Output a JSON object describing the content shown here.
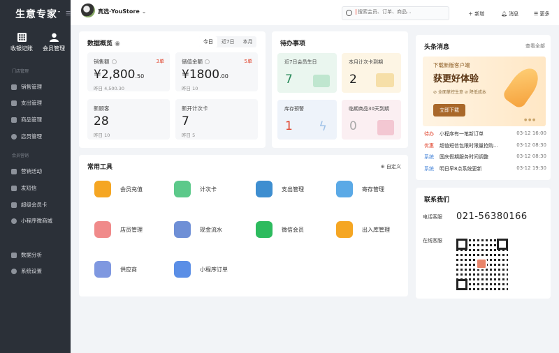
{
  "sidebar": {
    "logo": "生意专家",
    "logo_tm": "™",
    "top": [
      {
        "label": "收银记账"
      },
      {
        "label": "会员管理"
      }
    ],
    "section1": "门店管理",
    "items1": [
      {
        "label": "销售管理"
      },
      {
        "label": "支出管理"
      },
      {
        "label": "商品管理"
      },
      {
        "label": "店员管理"
      }
    ],
    "section2": "会员营销",
    "items2": [
      {
        "label": "营销活动"
      },
      {
        "label": "发短信"
      },
      {
        "label": "超级会员卡"
      },
      {
        "label": "小程序微商城"
      }
    ],
    "items3": [
      {
        "label": "数据分析"
      },
      {
        "label": "系统设置"
      }
    ]
  },
  "header": {
    "store": "真选·YouStore",
    "search_placeholder": "搜索会员、订单、商品...",
    "add": "新增",
    "messages": "消息",
    "more": "更多"
  },
  "overview": {
    "title": "数据概览",
    "tabs": [
      "今日",
      "近7日",
      "本月"
    ],
    "stats": [
      {
        "label": "销售额",
        "badge": "3单",
        "value": "¥2,800",
        "decimal": ".50",
        "sub": "昨日 4,500.30"
      },
      {
        "label": "储值金额",
        "badge": "5单",
        "value": "¥1800",
        "decimal": ".00",
        "sub": "昨日 10"
      },
      {
        "label": "新顾客",
        "value": "28",
        "sub": "昨日 10"
      },
      {
        "label": "新开计次卡",
        "value": "7",
        "sub": "昨日 5"
      }
    ]
  },
  "todo": {
    "title": "待办事项",
    "items": [
      {
        "label": "近7日会员生日",
        "value": "7",
        "color": "#2a8a5a"
      },
      {
        "label": "本月计次卡到期",
        "value": "2",
        "color": "#222"
      },
      {
        "label": "库存预警",
        "value": "1",
        "color": "#e0442d"
      },
      {
        "label": "临期商品30天到期",
        "value": "0",
        "color": "#aaa"
      }
    ]
  },
  "tools": {
    "title": "常用工具",
    "customize": "自定义",
    "items": [
      {
        "label": "会员充值",
        "color": "#f5a623"
      },
      {
        "label": "计次卡",
        "color": "#5cc98a"
      },
      {
        "label": "支出管理",
        "color": "#3e8ed0"
      },
      {
        "label": "寄存管理",
        "color": "#5aa9e6"
      },
      {
        "label": "店员管理",
        "color": "#f08a8a"
      },
      {
        "label": "现金流水",
        "color": "#6e8fd6"
      },
      {
        "label": "微信会员",
        "color": "#2dbb5e"
      },
      {
        "label": "出入库管理",
        "color": "#f5a623"
      },
      {
        "label": "供应商",
        "color": "#7f98e0"
      },
      {
        "label": "小程序订单",
        "color": "#5a8ee6"
      }
    ]
  },
  "news": {
    "title": "头条消息",
    "view_all": "查看全部",
    "banner_small": "下载新版客户端",
    "banner_big": "获更好体验",
    "banner_f1": "全面掌控生意",
    "banner_f2": "降低成本",
    "banner_btn": "立即下载",
    "rows": [
      {
        "tag": "待办",
        "tag_color": "#e0442d",
        "text": "小程序有一笔新订单",
        "date": "03-12 16:00"
      },
      {
        "tag": "优惠",
        "tag_color": "#e0442d",
        "text": "超值短信包限时限量抢购...",
        "date": "03-12 08:30"
      },
      {
        "tag": "系统",
        "tag_color": "#3e7fd6",
        "text": "国庆假期服务时间调整",
        "date": "03-12 08:30"
      },
      {
        "tag": "系统",
        "tag_color": "#3e7fd6",
        "text": "明日早8点系统更新",
        "date": "03-12 19:30"
      }
    ]
  },
  "contact": {
    "title": "联系我们",
    "phone_label": "电话客服",
    "phone": "021-56380166",
    "online_label": "在线客服"
  }
}
